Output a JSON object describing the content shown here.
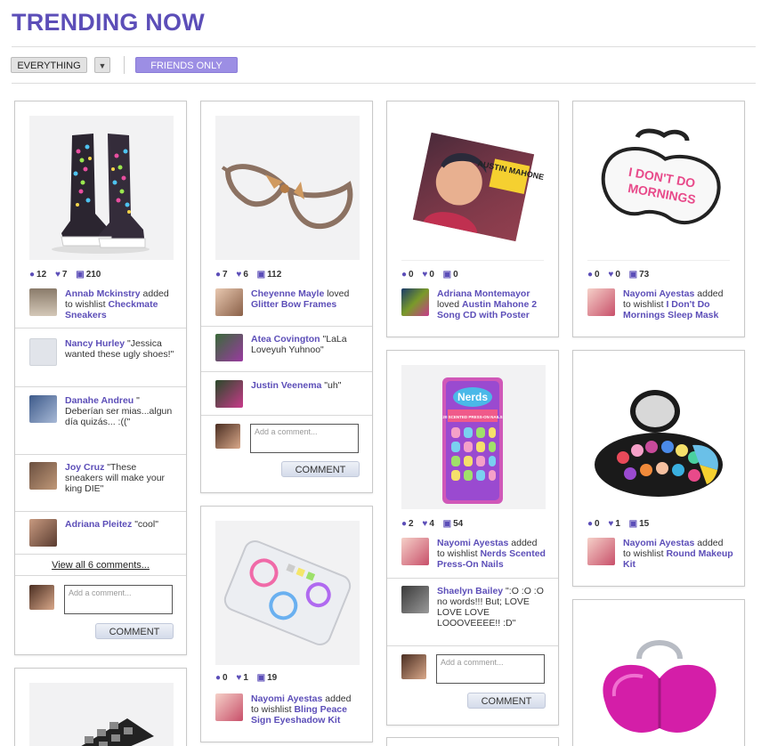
{
  "page": {
    "title": "TRENDING NOW",
    "filter_everything": "EVERYTHING",
    "filter_dropdown_icon": "chevron-down-icon",
    "filter_friends": "FRIENDS ONLY",
    "accent_color": "#5c4eb8"
  },
  "cards": [
    {
      "product": "Checkmate Sneakers",
      "stats": {
        "comments": "12",
        "loves": "7",
        "wishlists": "210"
      },
      "activity": {
        "user": "Annab Mckinstry",
        "action": "added to wishlist",
        "item": "Checkmate Sneakers"
      },
      "comments": [
        {
          "user": "Nancy Hurley",
          "text": "\"Jessica wanted these ugly shoes!\""
        },
        {
          "user": "Danahe Andreu",
          "text": "\" Deberían ser mias...algun día quizás... :((\""
        },
        {
          "user": "Joy Cruz",
          "text": "\"These sneakers will make your king DIE\""
        },
        {
          "user": "Adriana Pleitez",
          "text": "\"cool\""
        }
      ],
      "view_all": "View all 6 comments...",
      "comment_placeholder": "Add a comment...",
      "comment_button": "COMMENT"
    },
    {
      "product": "Glitter Bow Frames",
      "stats": {
        "comments": "7",
        "loves": "6",
        "wishlists": "112"
      },
      "activity": {
        "user": "Cheyenne Mayle",
        "action": "loved",
        "item": "Glitter Bow Frames"
      },
      "comments": [
        {
          "user": "Atea Covington",
          "text": "\"LaLa Loveyuh Yuhnoo\""
        },
        {
          "user": "Justin Veenema",
          "text": "\"uh\""
        }
      ],
      "comment_placeholder": "Add a comment...",
      "comment_button": "COMMENT"
    },
    {
      "product": "Austin Mahone 2 Song CD with Poster",
      "image_text": "AUSTIN MAHONE",
      "stats": {
        "comments": "0",
        "loves": "0",
        "wishlists": "0"
      },
      "activity": {
        "user": "Adriana Montemayor",
        "action": "loved",
        "item": "Austin Mahone 2 Song CD with Poster"
      }
    },
    {
      "product": "I Don't Do Mornings Sleep Mask",
      "image_text_1": "I DON'T DO",
      "image_text_2": "MORNINGS",
      "stats": {
        "comments": "0",
        "loves": "0",
        "wishlists": "73"
      },
      "activity": {
        "user": "Nayomi Ayestas",
        "action": "added to wishlist",
        "item": "I Don't Do Mornings Sleep Mask"
      }
    },
    {
      "product": "Nerds Scented Press-On Nails",
      "image_text_1": "Nerds",
      "image_text_2": "20 SCENTED PRESS-ON NAILS",
      "stats": {
        "comments": "2",
        "loves": "4",
        "wishlists": "54"
      },
      "activity": {
        "user": "Nayomi Ayestas",
        "action": "added to wishlist",
        "item": "Nerds Scented Press-On Nails"
      },
      "comments": [
        {
          "user": "Shaelyn Bailey",
          "text": "\":O :O :O no words!!! But; LOVE LOVE LOVE LOOOVEEEE!! :D\""
        }
      ],
      "comment_placeholder": "Add a comment...",
      "comment_button": "COMMENT"
    },
    {
      "product": "Round Makeup Kit",
      "stats": {
        "comments": "0",
        "loves": "1",
        "wishlists": "15"
      },
      "activity": {
        "user": "Nayomi Ayestas",
        "action": "added to wishlist",
        "item": "Round Makeup Kit"
      }
    },
    {
      "product": "Bling Peace Sign Eyeshadow Kit",
      "stats": {
        "comments": "0",
        "loves": "1",
        "wishlists": "19"
      },
      "activity": {
        "user": "Nayomi Ayestas",
        "action": "added to wishlist",
        "item": "Bling Peace Sign Eyeshadow Kit"
      }
    }
  ],
  "icons": {
    "comment": "speech-bubble-icon",
    "love": "heart-icon",
    "wishlist": "shopping-bag-icon"
  }
}
